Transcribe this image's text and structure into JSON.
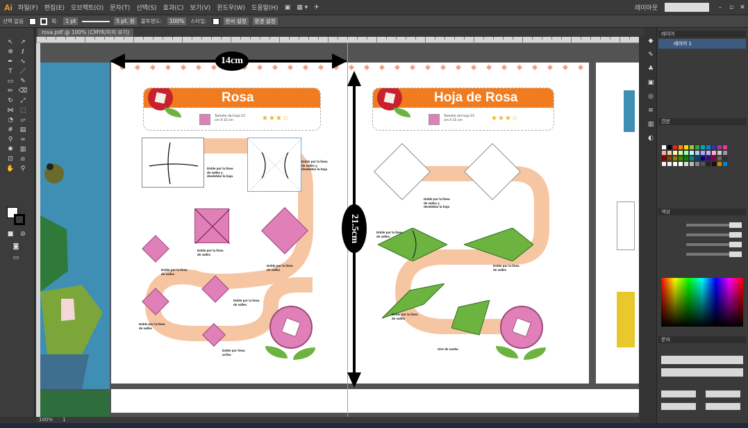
{
  "app": {
    "logo": "Ai"
  },
  "menu": {
    "items": [
      "파일(F)",
      "편집(E)",
      "오브젝트(O)",
      "문자(T)",
      "선택(S)",
      "효과(C)",
      "보기(V)",
      "윈도우(W)",
      "도움말(H)"
    ],
    "workspace": "레이아웃"
  },
  "control": {
    "label": "선택 없음",
    "stroke_label": "획:",
    "stroke_value": "1 pt",
    "brush": "5 pt. 원",
    "opacity_label": "불투명도:",
    "opacity_value": "100%",
    "style_label": "스타일:",
    "doc_setup": "문서 설정",
    "prefs": "환경 설정"
  },
  "document": {
    "tab_label": "rosa.pdf @ 100% (CMYK/미리 보기)"
  },
  "status": {
    "zoom": "100%",
    "page": "1"
  },
  "rosa": {
    "title": "Rosa",
    "size": "Tamaño del hoja 15 cm X 15 cm",
    "stars": "★★★☆"
  },
  "hoja": {
    "title": "Hoja de Rosa",
    "size": "Tamaño del hoja 15 cm X 15 cm",
    "stars": "★★★☆"
  },
  "notes": {
    "n1": "Doble por la línea de valles y desdoblar la hoja",
    "n2": "Doble por la línea de valles y desdoblar la hoja",
    "n3": "Doble por la línea de valles",
    "n4": "Doble por la línea de valles",
    "n5": "Doble por la línea de valles",
    "n6": "Doble por la línea de valles",
    "n7": "Doble por la línea de valles",
    "n8": "Doble por la línea de valles",
    "n9": "Doble por línea arriba",
    "h1": "Doble por la línea de valles y desdoblar la hoja",
    "h2": "Doble por la línea de valles",
    "h3": "Doble por la línea de valles",
    "h4": "Doble por la línea de valles",
    "h5": "Gire de vuelta"
  },
  "measure": {
    "width": "14cm",
    "height": "21.5cm"
  },
  "panels": {
    "layers_tab": "레이어",
    "layer_name": "레이어 1",
    "swatches_tab": "견본",
    "color_tab": "색상",
    "char_tab": "문자"
  },
  "colors": {
    "orange": "#f07c1f",
    "pink": "#e07fb8",
    "green": "#6cb33f",
    "red": "#c8202c",
    "peach": "#f6c6a3"
  }
}
